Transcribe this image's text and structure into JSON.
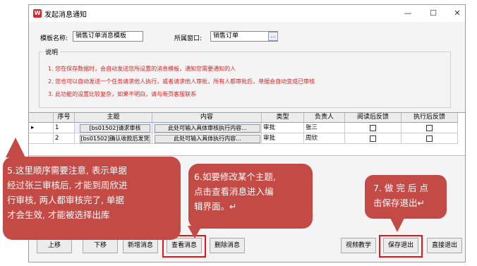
{
  "window": {
    "title": "发起消息通知",
    "minimize": "—",
    "maximize": "☐",
    "close": "✕"
  },
  "form": {
    "template_name_label": "模板名称:",
    "template_name_value": "销售订单消息模板",
    "window_label": "所属窗口:",
    "window_value": "销售订单",
    "ellipsis": "..."
  },
  "notes": {
    "header": "说明",
    "lines": [
      "1. 您在保存数据时，会自动发送您所设置的消息模板，通知您需要通知的人",
      "2. 您也可以自动发送一个任务请求他人执行，或者请求他人审批，所有人都审批后，单据会自动变成已审核",
      "3. 此功能的设置比较复杂，如果不明白，请与新页客服联系"
    ]
  },
  "grid": {
    "headers": [
      "序号",
      "主题",
      "内容",
      "类型",
      "负责人",
      "阅读后反馈",
      "执行后反馈"
    ],
    "rows": [
      {
        "seq": "1",
        "subject": "[bs01502]请求审核",
        "content": "此处可输入具体审核执行内容...",
        "type": "审批",
        "owner": "张三",
        "read_feedback": false,
        "exec_feedback": false,
        "selected": true
      },
      {
        "seq": "2",
        "subject": "[bs01502]确认收款后发货",
        "content": "此处可输入具体执行内容...",
        "type": "审批",
        "owner": "周欣",
        "read_feedback": false,
        "exec_feedback": false,
        "selected": false
      }
    ]
  },
  "buttons": {
    "move_up": "上移",
    "move_down": "下移",
    "add_message": "新增消息",
    "view_message": "查看消息",
    "delete_message": "删除消息",
    "video_tutorial": "视频教学",
    "save_exit": "保存退出",
    "exit_direct": "直接退出"
  },
  "callouts": {
    "c5": [
      "5.这里顺序需要注意, 表示单据",
      "经过张三审核后, 才能到周欣进",
      "行审核, 两人都审核完了, 单据",
      "才会生效, 才能被选择出库"
    ],
    "c6": [
      "6.如要修改某个主题,",
      "点击查看消息进入编",
      "辑界面。↵"
    ],
    "c7": [
      "7. 做 完 后 点",
      "击保存退出↵"
    ]
  },
  "colors": {
    "callout": "#c44a46",
    "highlight": "#e8141a",
    "note_text": "#e02020"
  }
}
